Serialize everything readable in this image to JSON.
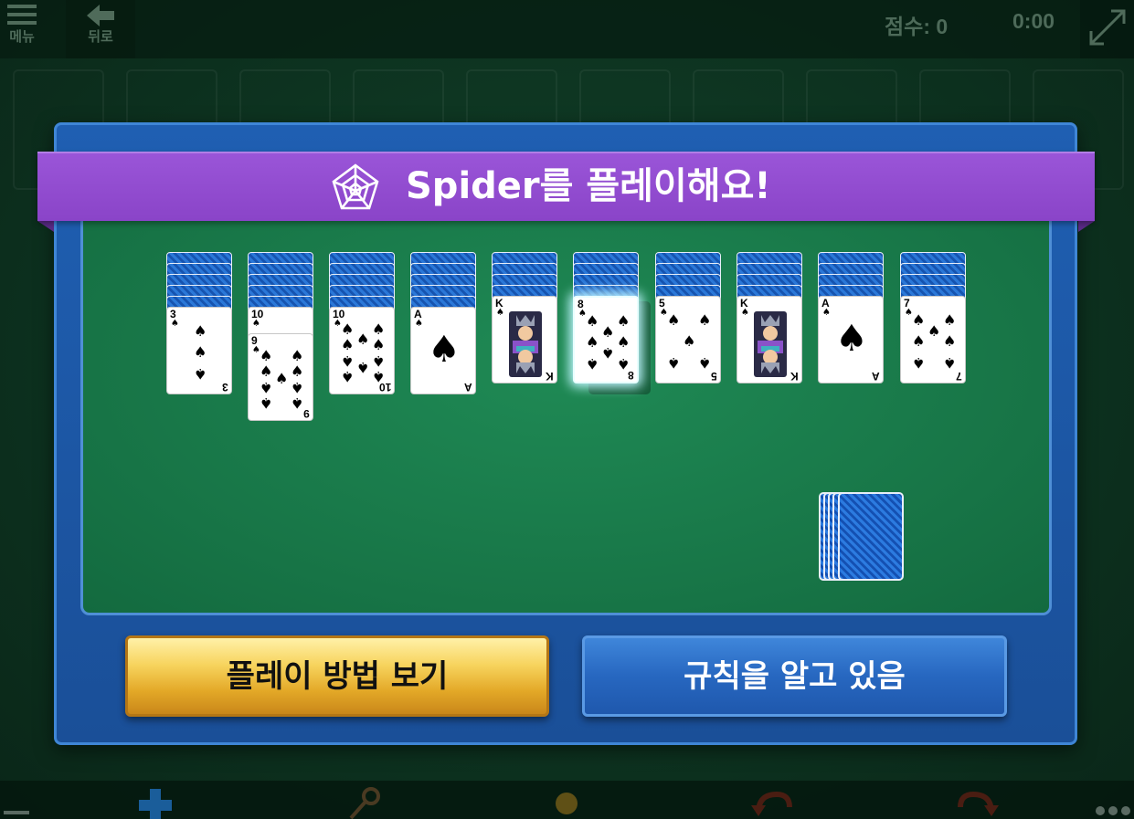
{
  "topbar": {
    "menu_label": "메뉴",
    "back_label": "뒤로",
    "score_text": "점수: 0",
    "time_text": "0:00"
  },
  "dialog": {
    "title": "Spider를 플레이해요!",
    "howto_button": "플레이 방법 보기",
    "know_rules_button": "규칙을 알고 있음"
  },
  "tableau": {
    "suit_symbol": "♠",
    "columns": [
      {
        "hidden": 5,
        "face_up": [
          "3"
        ]
      },
      {
        "hidden": 5,
        "face_up": [
          "10",
          "9"
        ]
      },
      {
        "hidden": 5,
        "face_up": [
          "10"
        ]
      },
      {
        "hidden": 5,
        "face_up": [
          "A"
        ]
      },
      {
        "hidden": 4,
        "face_up": [
          "K"
        ]
      },
      {
        "hidden": 4,
        "face_up": [
          "8"
        ],
        "selected": true
      },
      {
        "hidden": 4,
        "face_up": [
          "5"
        ]
      },
      {
        "hidden": 4,
        "face_up": [
          "K"
        ]
      },
      {
        "hidden": 4,
        "face_up": [
          "A"
        ]
      },
      {
        "hidden": 4,
        "face_up": [
          "7"
        ]
      }
    ]
  },
  "stock": {
    "piles": 5
  },
  "bottom_toolbar": [
    "plus-icon",
    "key-icon",
    "lightbulb-icon",
    "undo-icon",
    "redo-icon",
    "more-icon"
  ],
  "colors": {
    "banner": "#9a55d8",
    "dialog_blue": "#1f5fb2",
    "felt": "#1f8a55",
    "gold_button": "#f7d45e",
    "blue_button": "#2767c0"
  }
}
